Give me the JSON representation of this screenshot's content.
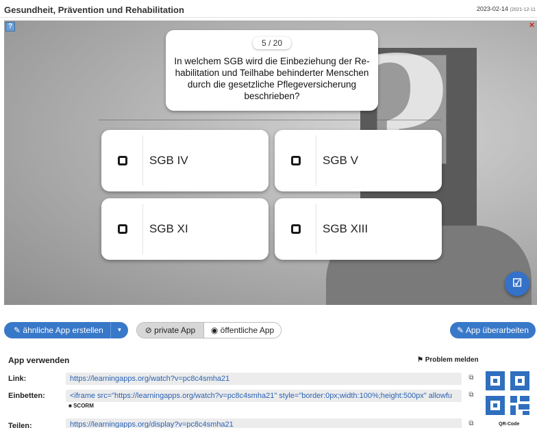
{
  "header": {
    "title": "Gesundheit, Prävention und Rehabilitation",
    "date": "2023-02-14",
    "created": "(2021-12-11"
  },
  "app": {
    "help_icon_glyph": "?",
    "fullscreen_icon_glyph": "✕",
    "counter": "5 / 20",
    "question": "In welchem SGB wird die Einbeziehung der Re-habilitation und Teilhabe behinderter Menschen durch die gesetzliche Pflegeversicherung beschrieben?",
    "answers": [
      {
        "label": "SGB IV"
      },
      {
        "label": "SGB V"
      },
      {
        "label": "SGB XI"
      },
      {
        "label": "SGB XIII"
      }
    ],
    "check_icon": "check-square-icon"
  },
  "actions": {
    "similar_label": "ähnliche App erstellen",
    "private_label": "private App",
    "public_label": "öffentliche App",
    "edit_label": "App überarbeiten",
    "accent_color": "#3878c8"
  },
  "use": {
    "header": "App verwenden",
    "report_label": "Problem melden",
    "rows": [
      {
        "label": "Link:",
        "value": "https://learningapps.org/watch?v=pc8c4smha21"
      },
      {
        "label": "Einbetten:",
        "value": "<iframe src=\"https://learningapps.org/watch?v=pc8c4smha21\" style=\"border:0px;width:100%;height:500px\" allowfu"
      },
      {
        "label": "Teilen:",
        "value": "https://learningapps.org/display?v=pc8c4smha21"
      }
    ],
    "scorm_label": "SCORM",
    "qr_label": "QR-Code"
  }
}
